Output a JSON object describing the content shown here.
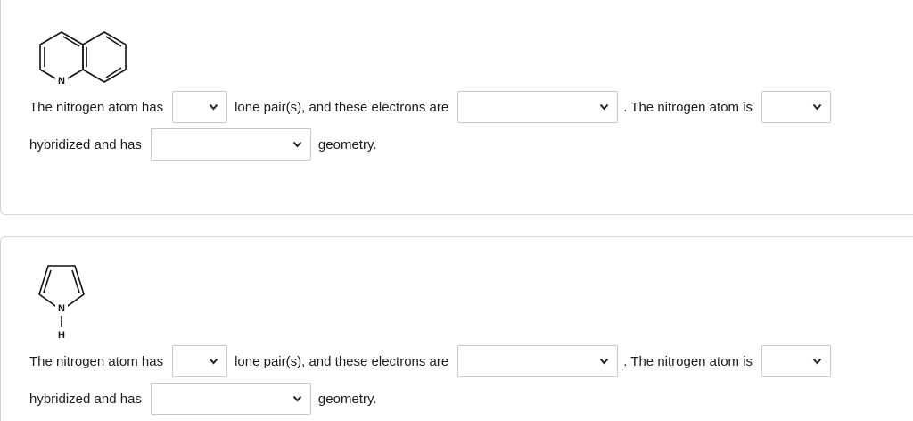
{
  "questions": [
    {
      "molecule": {
        "name": "quinoline",
        "atom_label": "N"
      },
      "line1": {
        "part1": "The nitrogen atom has",
        "part2": "lone pair(s), and these electrons are",
        "part3": ". The nitrogen atom is"
      },
      "line2": {
        "part1": "hybridized and has",
        "part2": "geometry."
      },
      "dropdowns": {
        "lone_pairs": "",
        "electrons_are": "",
        "hybridization": "",
        "geometry": ""
      }
    },
    {
      "molecule": {
        "name": "pyrrole",
        "atom_label": "N",
        "h_label": "H"
      },
      "line1": {
        "part1": "The nitrogen atom has",
        "part2": "lone pair(s), and these electrons are",
        "part3": ". The nitrogen atom is"
      },
      "line2": {
        "part1": "hybridized and has",
        "part2": "geometry."
      },
      "dropdowns": {
        "lone_pairs": "",
        "electrons_are": "",
        "hybridization": "",
        "geometry": ""
      }
    }
  ],
  "icons": {
    "dropdown": "chevron-down-icon"
  }
}
